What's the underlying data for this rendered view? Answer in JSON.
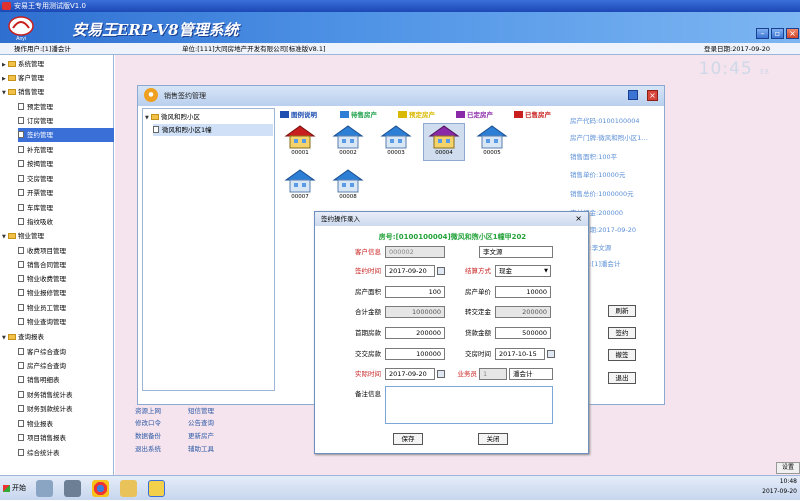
{
  "window": {
    "title": "安易王专用测试版V1.0"
  },
  "banner": {
    "brand": "安易王ERP-V8管理系统",
    "logo_text": "Anyi"
  },
  "strip": {
    "user": "操作用户:[1]潘会计",
    "unit": "单位:[111]大同房地产开发有限公司[标准版V8.1]",
    "login": "登录日期:2017-09-20"
  },
  "clock": {
    "time": "10:45",
    "sec": "38"
  },
  "sidebar": {
    "items": [
      {
        "label": "系统管理"
      },
      {
        "label": "客户管理"
      },
      {
        "label": "销售管理"
      },
      {
        "label": "预定管理"
      },
      {
        "label": "订房管理"
      },
      {
        "label": "签约管理"
      },
      {
        "label": "补充管理"
      },
      {
        "label": "按揭管理"
      },
      {
        "label": "交房管理"
      },
      {
        "label": "开票管理"
      },
      {
        "label": "车库管理"
      },
      {
        "label": "指纹吸收"
      },
      {
        "label": "物业管理"
      },
      {
        "label": "收费项目管理"
      },
      {
        "label": "销售合同管理"
      },
      {
        "label": "物业收费管理"
      },
      {
        "label": "物业报修管理"
      },
      {
        "label": "物业员工管理"
      },
      {
        "label": "物业查询管理"
      },
      {
        "label": "查询报表"
      },
      {
        "label": "客户综合查询"
      },
      {
        "label": "房产综合查询"
      },
      {
        "label": "销售明细表"
      },
      {
        "label": "财务销售统计表"
      },
      {
        "label": "财务到款统计表"
      },
      {
        "label": "物业报表"
      },
      {
        "label": "项目销售报表"
      },
      {
        "label": "综合统计表"
      }
    ]
  },
  "dialog1": {
    "title": "销售签约管理",
    "tree": [
      {
        "label": "微风和煦小区"
      },
      {
        "label": "微风和煦小区1幢"
      }
    ],
    "legend": [
      {
        "label": "图例说明",
        "color": "#1e4fb0"
      },
      {
        "label": "待售房产",
        "color": "#1ea04a"
      },
      {
        "label": "预定房产",
        "color": "#d9b800"
      },
      {
        "label": "已定房产",
        "color": "#8a2aa8"
      },
      {
        "label": "已售房产",
        "color": "#c81e1e"
      }
    ],
    "houses": [
      {
        "code": "00001",
        "roof": "#c81e1e"
      },
      {
        "code": "00002",
        "roof": "#2d7fd6"
      },
      {
        "code": "00003",
        "roof": "#2d7fd6"
      },
      {
        "code": "00004",
        "roof": "#8a2aa8"
      },
      {
        "code": "00005",
        "roof": "#2d7fd6"
      },
      {
        "code": "00007",
        "roof": "#2d7fd6"
      },
      {
        "code": "00008",
        "roof": "#2d7fd6"
      }
    ],
    "info": [
      "房产代码:0100100004",
      "房产门牌:微风和煦小区1…",
      "销售面积:100平",
      "销售单价:10000元",
      "销售总价:1000000元",
      "应付订金:200000",
      "签约日期:2017-09-20",
      "业务员:李文源",
      "会计员:[1]潘会计"
    ],
    "buttons": {
      "refresh": "刷新",
      "sign": "签约",
      "cancel": "撤签",
      "exit": "退出"
    }
  },
  "dialog2": {
    "title": "签约操作录入",
    "close": "×",
    "head": "房号:[0100100004]微风和煦小区1幢甲202",
    "fields": {
      "customer_label": "客户信息",
      "customer_code": "000002",
      "customer_name": "李文源",
      "sign_time_label": "签约时间",
      "sign_time": "2017-09-20",
      "pay_method_label": "结算方式",
      "pay_method": "现金",
      "area_label": "房产面积",
      "area": "100",
      "unit_price_label": "房产单价",
      "unit_price": "10000",
      "total_label": "合计金额",
      "total": "1000000",
      "deposit_label": "转交定金",
      "deposit": "200000",
      "first_pay_label": "首期房款",
      "first_pay": "200000",
      "loan_label": "贷款金额",
      "loan": "500000",
      "handover_label": "交交房款",
      "handover": "100000",
      "handover_date_label": "交房时间",
      "handover_date": "2017-10-15",
      "actual_time_label": "实际时间",
      "actual_time": "2017-09-20",
      "salesman_label": "业务员",
      "salesman_code": "1",
      "salesman_name": "潘会计",
      "remark_label": "备注信息"
    },
    "buttons": {
      "save": "保存",
      "close": "关闭"
    }
  },
  "bottom_links": [
    [
      "资源上网",
      "短信管理"
    ],
    [
      "修改口令",
      "公告查询"
    ],
    [
      "数据备份",
      "更新房产"
    ],
    [
      "退出系统",
      "辅助工具"
    ]
  ],
  "taskbar": {
    "start": "开始",
    "time": "10:48",
    "date": "2017-09-20"
  },
  "settings": "设置"
}
